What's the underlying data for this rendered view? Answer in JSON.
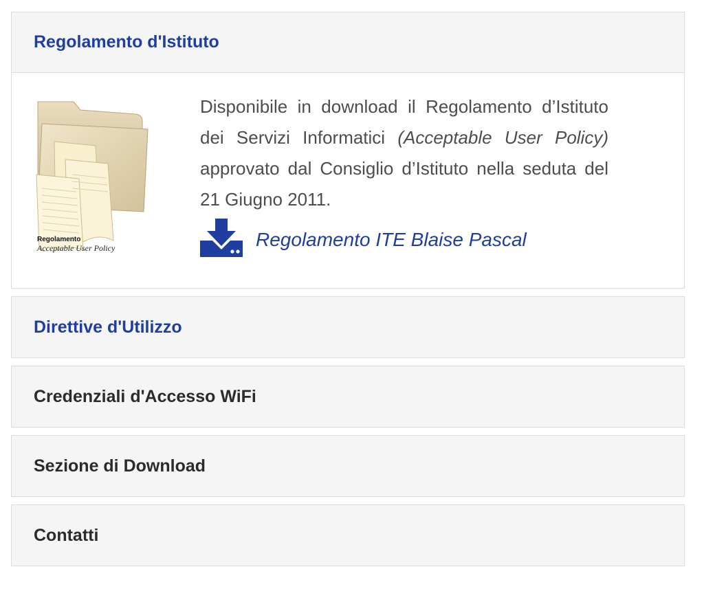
{
  "accordion": {
    "panels": [
      {
        "title": "Regolamento d'Istituto",
        "expanded": true,
        "title_color": "#1f3ea0",
        "body": {
          "thumbnail": {
            "icon": "folder-documents-icon",
            "caption_line1": "Regolamento",
            "caption_line2": "Acceptable User Policy"
          },
          "description_part1": "Disponibile in download il Regolamento d’Istituto dei Servizi Informatici ",
          "description_italic": "(Acceptable User Policy)",
          "description_part2": " approvato dal Consiglio d’Istituto nella seduta del 21 Giugno 2011.",
          "download_icon": "download-icon",
          "download_link": "Regolamento ITE Blaise Pascal"
        }
      },
      {
        "title": "Direttive d'Utilizzo",
        "expanded": false,
        "title_color": "#1f3ea0"
      },
      {
        "title": "Credenziali d'Accesso WiFi",
        "expanded": false,
        "title_color": "#2b2b2b"
      },
      {
        "title": "Sezione di Download",
        "expanded": false,
        "title_color": "#2b2b2b"
      },
      {
        "title": "Contatti",
        "expanded": false,
        "title_color": "#2b2b2b"
      }
    ]
  },
  "colors": {
    "accent": "#1f3ea0",
    "header_bg": "#f5f5f5",
    "border": "#dcdcdc",
    "body_text": "#4d4d4d"
  }
}
